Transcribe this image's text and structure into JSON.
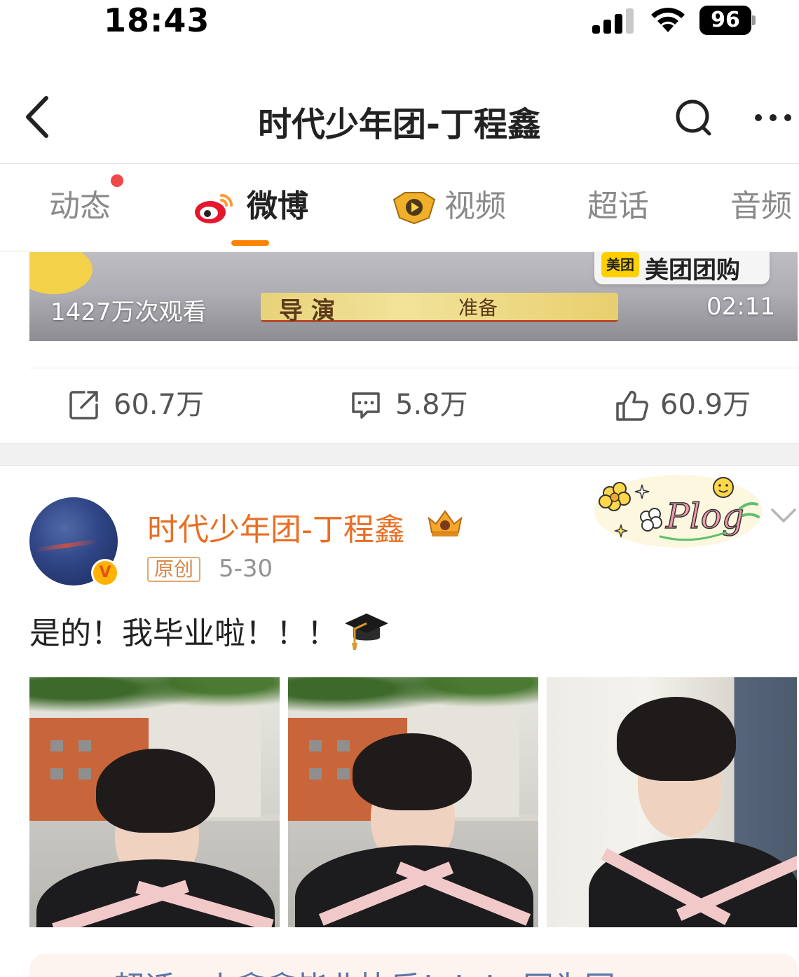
{
  "status_bar": {
    "time": "18:43",
    "battery": "96"
  },
  "nav": {
    "title": "时代少年团-丁程鑫"
  },
  "tabs": [
    {
      "label": "动态",
      "has_dot": true
    },
    {
      "label": "微博",
      "active": true
    },
    {
      "label": "视频"
    },
    {
      "label": "超话"
    },
    {
      "label": "音频"
    }
  ],
  "video": {
    "views": "1427万次观看",
    "duration": "02:11",
    "banner_left": "导演",
    "banner_mid": "准备",
    "sponsor_logo": "美团",
    "sponsor_text": "美团团购"
  },
  "actions": {
    "repost": "60.7万",
    "comment": "5.8万",
    "like": "60.9万"
  },
  "post": {
    "author": "时代少年团-丁程鑫",
    "tag": "原创",
    "date": "5-30",
    "text": "是的！我毕业啦！！！",
    "verified_badge": "V",
    "sticker": "Plog"
  },
  "topic": {
    "text": "超话 · 小鑫鑫毕业快乐！！！ 同为国"
  },
  "colors": {
    "accent": "#ff8200",
    "author": "#e86f24",
    "topic_link": "#5576a8"
  }
}
